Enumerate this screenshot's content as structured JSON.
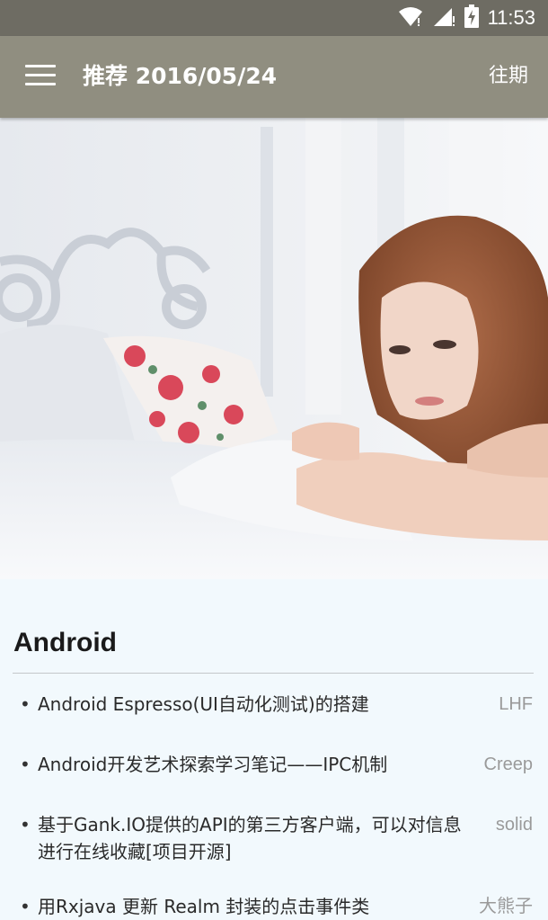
{
  "status_bar": {
    "time": "11:53",
    "icons": [
      "wifi-icon",
      "signal-icon",
      "battery-charging-icon"
    ]
  },
  "app_bar": {
    "title": "推荐 2016/05/24",
    "history_label": "往期",
    "menu_icon": "menu-icon"
  },
  "colors": {
    "status_bar": "#6e6c63",
    "app_bar": "#908e80",
    "background": "#f2f9fd"
  },
  "section": {
    "title": "Android",
    "items": [
      {
        "title": "Android Espresso(UI自动化测试)的搭建",
        "author": "LHF"
      },
      {
        "title": "Android开发艺术探索学习笔记——IPC机制",
        "author": "Creep"
      },
      {
        "title": "基于Gank.IO提供的API的第三方客户端，可以对信息进行在线收藏[项目开源]",
        "author": "solid"
      },
      {
        "title": "用Rxjava 更新 Realm 封装的点击事件类",
        "author": "大熊子"
      }
    ]
  }
}
